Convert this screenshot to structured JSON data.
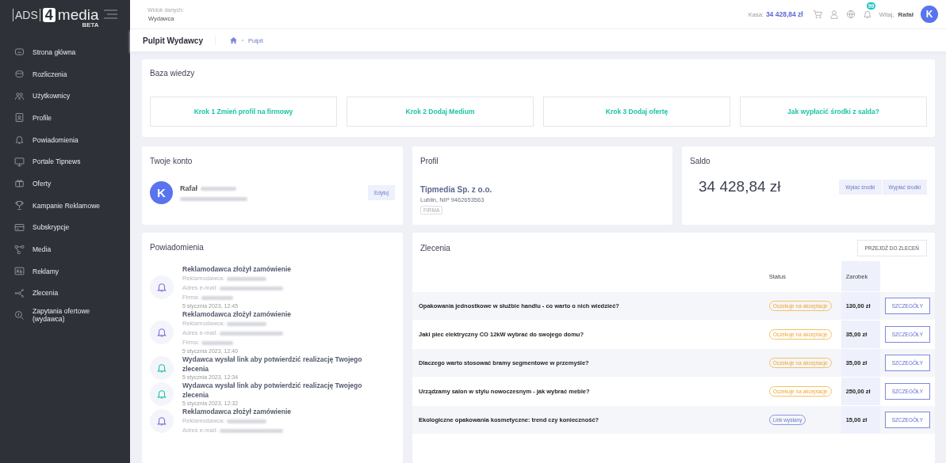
{
  "logo": {
    "left": "ADS",
    "digit": "4",
    "word": "media",
    "tag": "BETA"
  },
  "sidebar": {
    "items": [
      {
        "label": "Strona główna",
        "selected": false
      },
      {
        "label": "Rozliczenia",
        "selected": false
      },
      {
        "label": "Użytkownicy",
        "selected": false
      },
      {
        "label": "Profile",
        "selected": false
      },
      {
        "label": "Powiadomienia",
        "selected": false
      },
      {
        "label": "Portale Tipnews",
        "selected": false
      },
      {
        "label": "Oferty",
        "selected": false
      },
      {
        "label": "Kampanie Reklamowe",
        "selected": false
      },
      {
        "label": "Subskrypcje",
        "selected": false
      },
      {
        "label": "Media",
        "selected": false
      },
      {
        "label": "Reklamy",
        "selected": false
      },
      {
        "label": "Zlecenia",
        "selected": false
      },
      {
        "label": "Zapytania ofertowe (wydawca)",
        "selected": false
      }
    ]
  },
  "header": {
    "view_label": "Widok danych:",
    "view_value": "Wydawca",
    "cash_label": "Kasa:",
    "cash_value": "34 428,84 zł",
    "badge": "99",
    "greeting": "Witaj,",
    "user": "Rafał",
    "avatar": "K"
  },
  "subheader": {
    "title": "Pulpit Wydawcy",
    "breadcrumb": "Pulpit"
  },
  "knowledge": {
    "title": "Baza wiedzy",
    "links": [
      "Krok 1 Zmień profil na firmowy",
      "Krok 2 Dodaj Medium",
      "Krok 3 Dodaj ofertę",
      "Jak wypłacić środki z salda?"
    ]
  },
  "account": {
    "title": "Twoje konto",
    "avatar": "K",
    "name": "Rafał",
    "edit": "Edytuj"
  },
  "profile": {
    "title": "Profil",
    "company": "Tipmedia Sp. z o.o.",
    "details": "Lublin, NIP 9462653563",
    "tag": "FIRMA"
  },
  "balance": {
    "title": "Saldo",
    "amount": "34 428,84 zł",
    "buttons": [
      "Wpłać środki",
      "Wypłać środki"
    ]
  },
  "notifications": {
    "title": "Powiadomienia",
    "items": [
      {
        "kind": "order",
        "title": "Reklamodawca złożył zamówienie",
        "fields": [
          "Reklamodawca:",
          "Adres e-mail:",
          "Firma:"
        ],
        "time": "5 stycznia 2023, 12:45"
      },
      {
        "kind": "order",
        "title": "Reklamodawca złożył zamówienie",
        "fields": [
          "Reklamodawca:",
          "Adres e-mail:",
          "Firma:"
        ],
        "time": "5 stycznia 2023, 12:40"
      },
      {
        "kind": "link",
        "title": "Wydawca wysłał link aby potwierdzić realizację Twojego zlecenia",
        "time": "5 stycznia 2023, 12:34"
      },
      {
        "kind": "link",
        "title": "Wydawca wysłał link aby potwierdzić realizację Twojego zlecenia",
        "time": "5 stycznia 2023, 12:32"
      },
      {
        "kind": "order",
        "title": "Reklamodawca złożył zamówienie",
        "fields": [
          "Reklamodawca:",
          "Adres e-mail:"
        ]
      }
    ]
  },
  "orders": {
    "title": "Zlecenia",
    "action": "PRZEJDŹ DO ZLECEŃ",
    "columns": [
      "Status",
      "Zarobek"
    ],
    "rows": [
      {
        "title": "Opakowania jednostkowe w służbie handlu - co warto o nich wiedzieć?",
        "status": {
          "label": "Oczekuje na akceptacje",
          "kind": "pending"
        },
        "earning": "130,00 zł",
        "button": "SZCZEGÓŁY"
      },
      {
        "title": "Jaki piec elektryczny CO 12kW wybrać do swojego domu?",
        "status": {
          "label": "Oczekuje na akceptacje",
          "kind": "pending"
        },
        "earning": "35,00 zł",
        "button": "SZCZEGÓŁY"
      },
      {
        "title": "Dlaczego warto stosować bramy segmentowe w przemyśle?",
        "status": {
          "label": "Oczekuje na akceptacje",
          "kind": "pending"
        },
        "earning": "35,00 zł",
        "button": "SZCZEGÓŁY"
      },
      {
        "title": "Urządzamy salon w stylu nowoczesnym - jak wybrać meble?",
        "status": {
          "label": "Oczekuje na akceptacje",
          "kind": "pending"
        },
        "earning": "250,00 zł",
        "button": "SZCZEGÓŁY"
      },
      {
        "title": "Ekologiczne opakowania kosmetyczne: trend czy konieczność?",
        "status": {
          "label": "Link wysłany",
          "kind": "sent"
        },
        "earning": "15,00 zł",
        "button": "SZCZEGÓŁY"
      }
    ]
  }
}
